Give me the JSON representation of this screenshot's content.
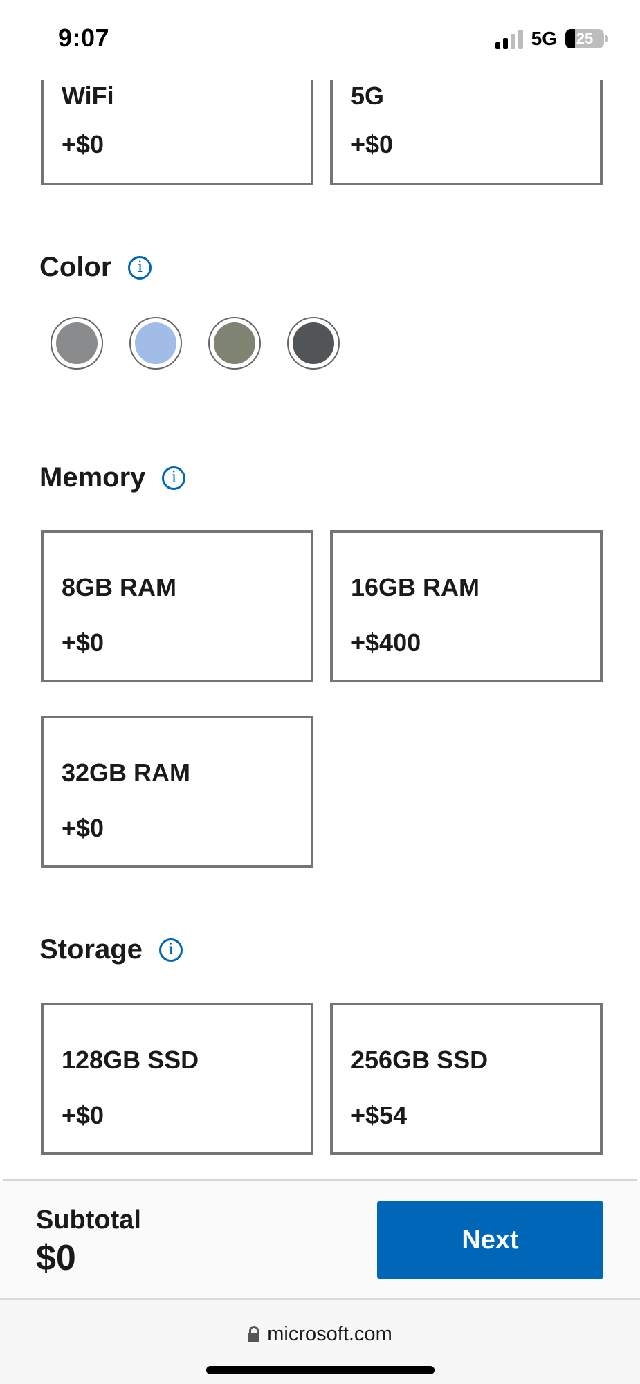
{
  "status_bar": {
    "time": "9:07",
    "network": "5G",
    "battery": "25",
    "battery_level": 0.25
  },
  "connectivity": {
    "options": [
      {
        "name": "WiFi",
        "price": "+$0"
      },
      {
        "name": "5G",
        "price": "+$0"
      }
    ]
  },
  "color": {
    "title": "Color",
    "swatches": [
      "#8a8b8d",
      "#a2bce8",
      "#7e8372",
      "#525557"
    ]
  },
  "memory": {
    "title": "Memory",
    "options": [
      {
        "name": "8GB RAM",
        "price": "+$0"
      },
      {
        "name": "16GB RAM",
        "price": "+$400"
      },
      {
        "name": "32GB RAM",
        "price": "+$0"
      }
    ]
  },
  "storage": {
    "title": "Storage",
    "options": [
      {
        "name": "128GB SSD",
        "price": "+$0"
      },
      {
        "name": "256GB SSD",
        "price": "+$54"
      }
    ]
  },
  "footer": {
    "subtotal_label": "Subtotal",
    "subtotal_value": "$0",
    "next_label": "Next"
  },
  "browser": {
    "url": "microsoft.com"
  },
  "colors": {
    "accent": "#0067b8",
    "card_border": "#757575"
  }
}
